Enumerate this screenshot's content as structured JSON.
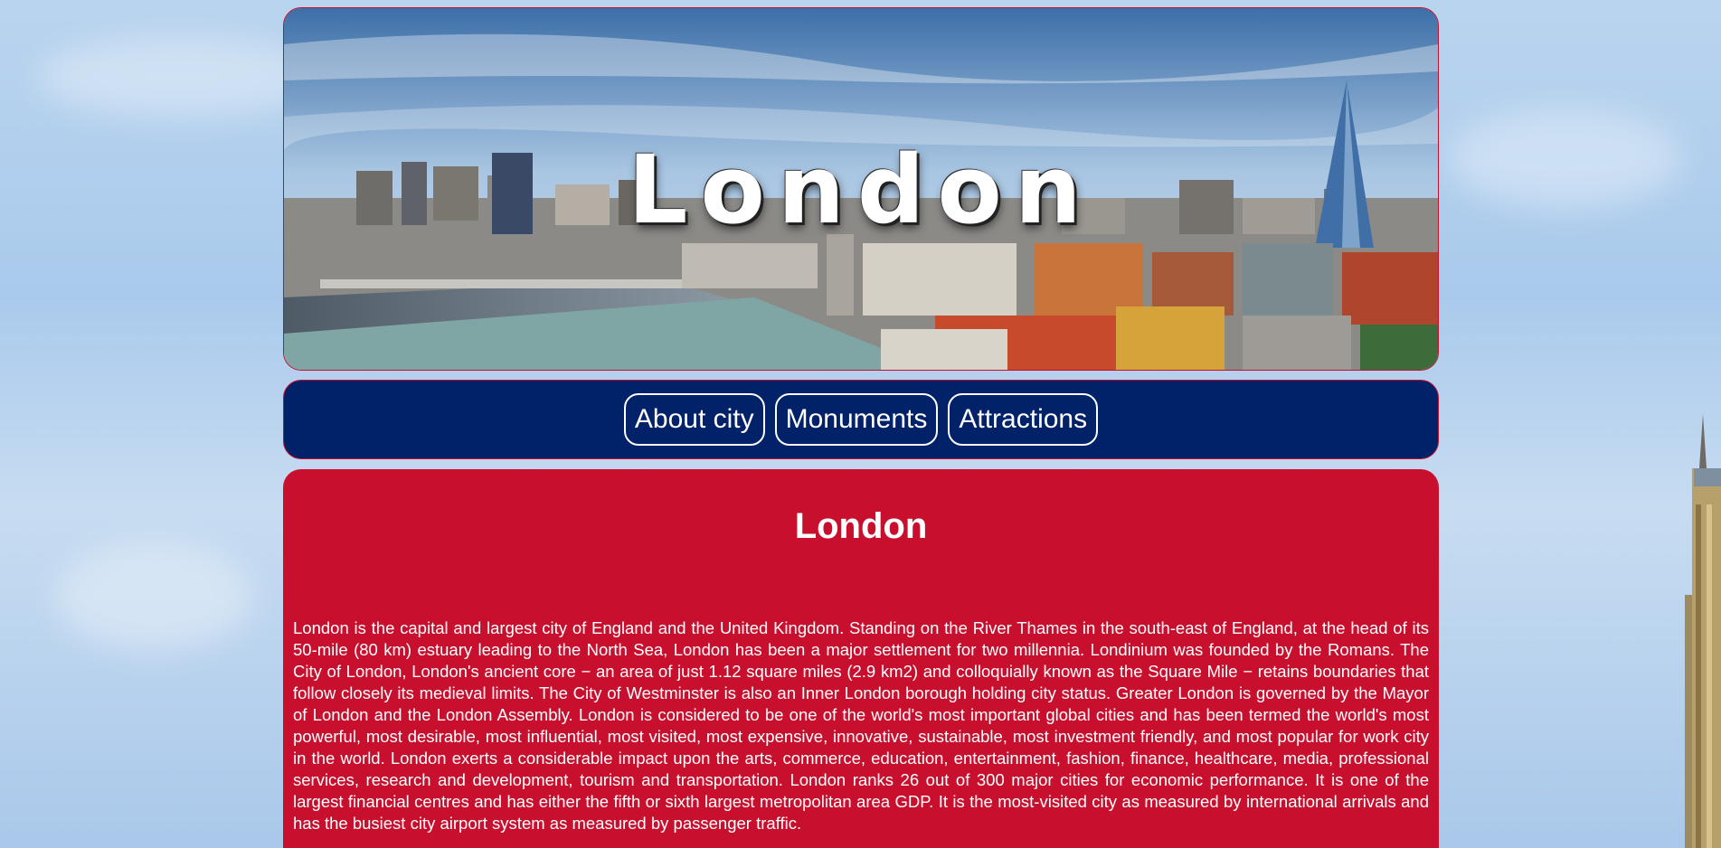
{
  "banner": {
    "title": "London"
  },
  "nav": {
    "items": [
      {
        "label": "About city"
      },
      {
        "label": "Monuments"
      },
      {
        "label": "Attractions"
      }
    ]
  },
  "content": {
    "heading": "London",
    "body": "London is the capital and largest city of England and the United Kingdom. Standing on the River Thames in the south-east of England, at the head of its 50-mile (80 km) estuary leading to the North Sea, London has been a major settlement for two millennia. Londinium was founded by the Romans. The City of London, London's ancient core − an area of just 1.12 square miles (2.9 km2) and colloquially known as the Square Mile − retains boundaries that follow closely its medieval limits. The City of Westminster is also an Inner London borough holding city status. Greater London is governed by the Mayor of London and the London Assembly. London is considered to be one of the world's most important global cities and has been termed the world's most powerful, most desirable, most influential, most visited, most expensive, innovative, sustainable, most investment friendly, and most popular for work city in the world. London exerts a considerable impact upon the arts, commerce, education, entertainment, fashion, finance, healthcare, media, professional services, research and development, tourism and transportation. London ranks 26 out of 300 major cities for economic performance. It is one of the largest financial centres and has either the fifth or sixth largest metropolitan area GDP. It is the most-visited city as measured by international arrivals and has the busiest city airport system as measured by passenger traffic."
  },
  "colors": {
    "red": "#c8102e",
    "navy": "#012169",
    "sky": "#aacaec",
    "white": "#ffffff"
  }
}
